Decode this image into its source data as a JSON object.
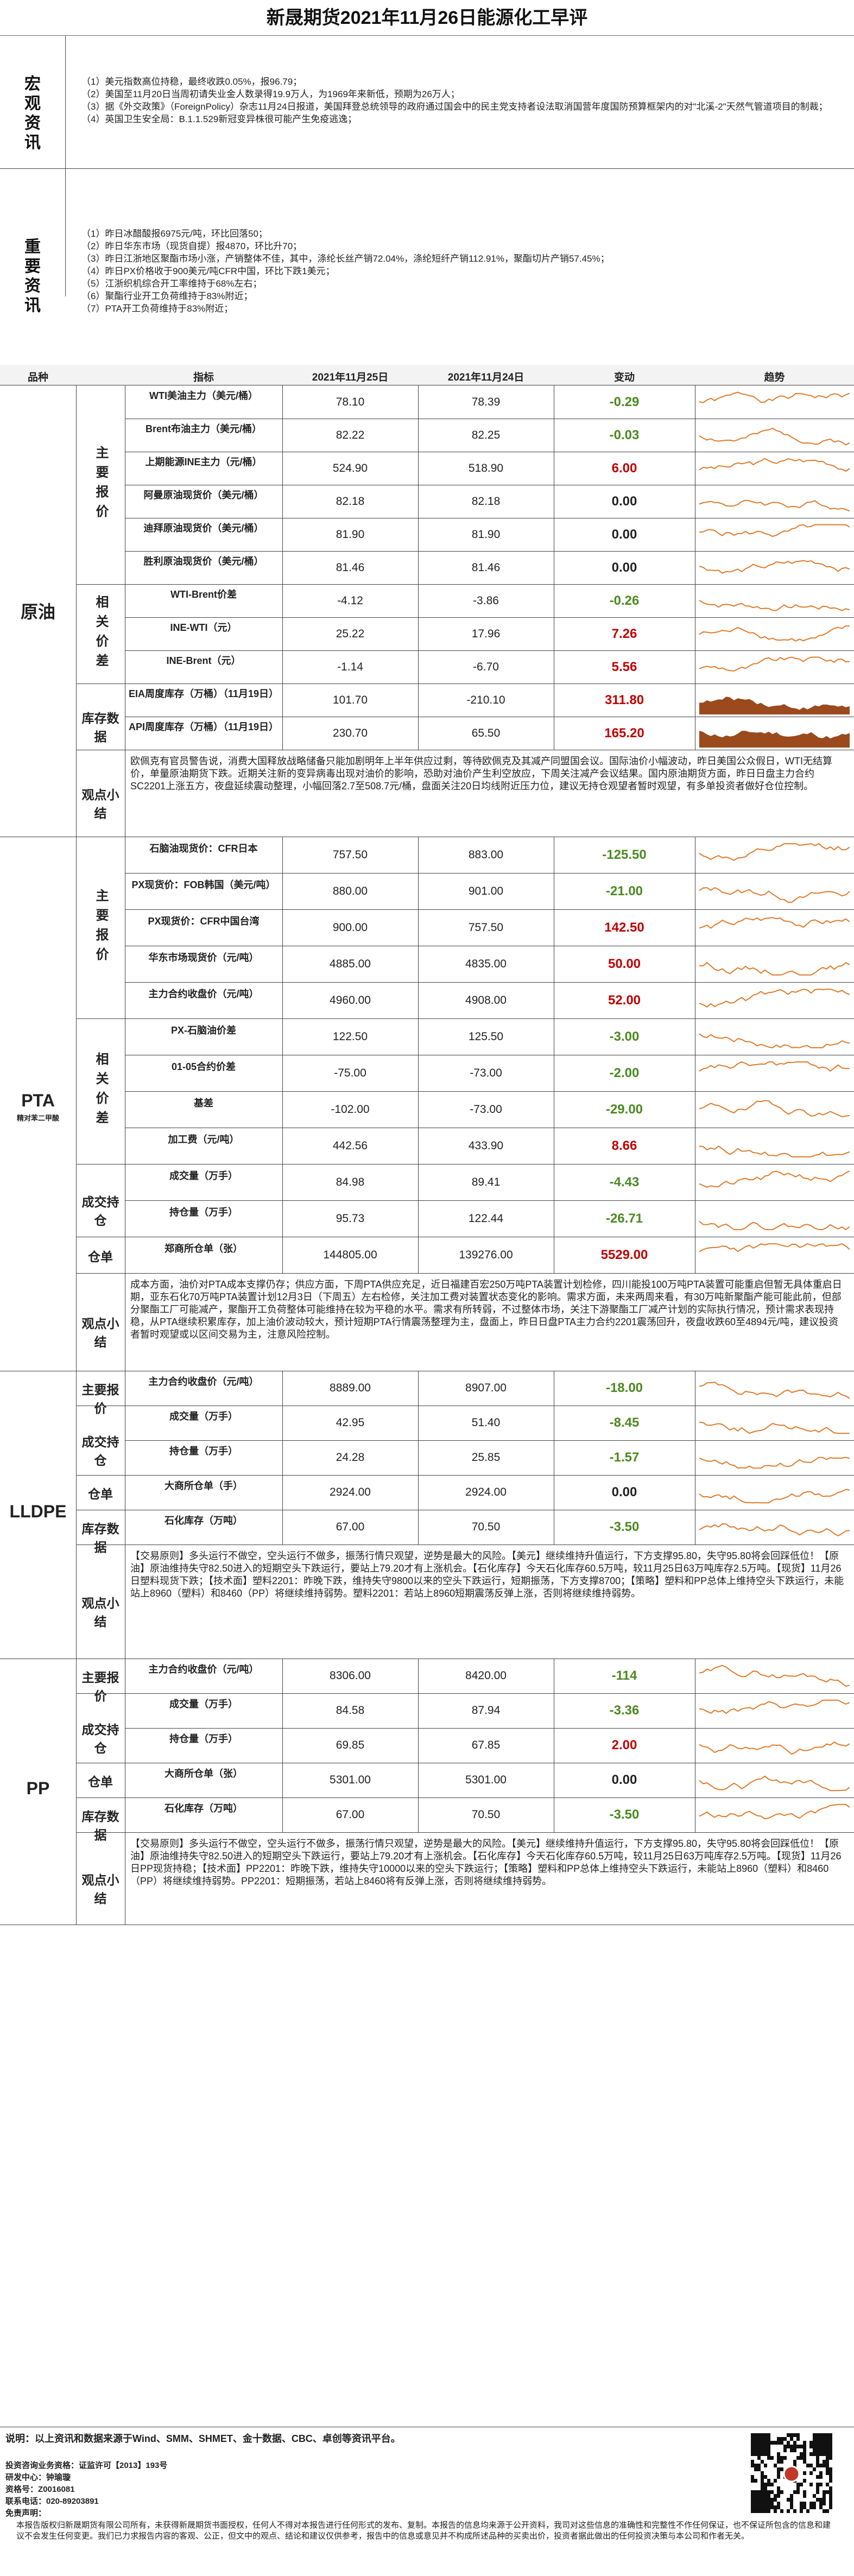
{
  "title": "新晟期货2021年11月26日能源化工早评",
  "macro": {
    "label": "宏观资讯",
    "items": [
      "（1）美元指数高位持稳，最终收跌0.05%，报96.79；",
      "（2）美国至11月20日当周初请失业金人数录得19.9万人，为1969年来新低，预期为26万人；",
      "（3）据《外交政策》（ForeignPolicy）杂志11月24日报道，美国拜登总统领导的政府通过国会中的民主党支持者设法取消国营年度国防预算框架内的对\"北溪-2\"天然气管道项目的制裁；",
      "（4）英国卫生安全局：B.1.1.529新冠变异株很可能产生免疫逃逸；"
    ]
  },
  "important": {
    "label": "重要资讯",
    "items": [
      "（1）昨日冰醋酸报6975元/吨，环比回落50；",
      "（2）昨日华东市场（现货自提）报4870，环比升70；",
      "（3）昨日江浙地区聚酯市场小涨，产销整体不佳，其中，涤纶长丝产销72.04%，涤纶短纤产销112.91%，聚酯切片产销57.45%；",
      "（4）昨日PX价格收于900美元/吨CFR中国，环比下跌1美元；",
      "（5）江浙织机综合开工率维持于68%左右；",
      "（6）聚酯行业开工负荷维持于83%附近；",
      "（7）PTA开工负荷维持于83%附近；"
    ]
  },
  "table_header": {
    "product": "品种",
    "indicator": "指标",
    "date1": "2021年11月25日",
    "date2": "2021年11月24日",
    "change": "变动",
    "trend": "趋势"
  },
  "crude": {
    "name": "原油",
    "main_label": "主要报价",
    "rel_label": "相关价差",
    "inv_label": "库存数据",
    "summary_label": "观点小结",
    "rows": [
      {
        "name": "WTI美油主力（美元/桶）",
        "v1": "78.10",
        "v2": "78.39",
        "chg": "-0.29",
        "s": "neg"
      },
      {
        "name": "Brent布油主力（美元/桶）",
        "v1": "82.22",
        "v2": "82.25",
        "chg": "-0.03",
        "s": "neg"
      },
      {
        "name": "上期能源INE主力（元/桶）",
        "v1": "524.90",
        "v2": "518.90",
        "chg": "6.00",
        "s": "pos"
      },
      {
        "name": "阿曼原油现货价（美元/桶）",
        "v1": "82.18",
        "v2": "82.18",
        "chg": "0.00",
        "s": "zero"
      },
      {
        "name": "迪拜原油现货价（美元/桶）",
        "v1": "81.90",
        "v2": "81.90",
        "chg": "0.00",
        "s": "zero"
      },
      {
        "name": "胜利原油现货价（美元/桶）",
        "v1": "81.46",
        "v2": "81.46",
        "chg": "0.00",
        "s": "zero"
      },
      {
        "name": "WTI-Brent价差",
        "v1": "-4.12",
        "v2": "-3.86",
        "chg": "-0.26",
        "s": "neg"
      },
      {
        "name": "INE-WTI（元）",
        "v1": "25.22",
        "v2": "17.96",
        "chg": "7.26",
        "s": "pos"
      },
      {
        "name": "INE-Brent（元）",
        "v1": "-1.14",
        "v2": "-6.70",
        "chg": "5.56",
        "s": "pos"
      },
      {
        "name": "EIA周度库存（万桶）（11月19日）",
        "v1": "101.70",
        "v2": "-210.10",
        "chg": "311.80",
        "s": "pos"
      },
      {
        "name": "API周度库存（万桶）（11月19日）",
        "v1": "230.70",
        "v2": "65.50",
        "chg": "165.20",
        "s": "pos"
      }
    ],
    "summary": "欧佩克有官员警告说，消费大国释放战略储备只能加剧明年上半年供应过剩，等待欧佩克及其减产同盟国会议。国际油价小幅波动，昨日美国公众假日，WTI无结算价，单量原油期货下跌。近期关注新的变异病毒出现对油价的影响，恐助对油价产生利空放应，下周关注减产会议结果。国内原油期货方面，昨日日盘主力合约SC2201上涨五方，夜盘延续震动整理，小幅回落2.7至508.7元/桶，盘面关注20日均线附近压力位，建议无持仓观望者暂时观望，有多单投资者做好仓位控制。"
  },
  "pta": {
    "name": "PTA",
    "sub": "精对苯二甲酸",
    "main_label": "主要报价",
    "rel_label": "相关价差",
    "vol_label": "成交持仓",
    "wh_label": "仓单",
    "summary_label": "观点小结",
    "rows": [
      {
        "name": "石脑油现货价：CFR日本",
        "v1": "757.50",
        "v2": "883.00",
        "chg": "-125.50",
        "s": "neg"
      },
      {
        "name": "PX现货价：FOB韩国（美元/吨）",
        "v1": "880.00",
        "v2": "901.00",
        "chg": "-21.00",
        "s": "neg"
      },
      {
        "name": "PX现货价：CFR中国台湾",
        "v1": "900.00",
        "v2": "757.50",
        "chg": "142.50",
        "s": "pos"
      },
      {
        "name": "华东市场现货价（元/吨）",
        "v1": "4885.00",
        "v2": "4835.00",
        "chg": "50.00",
        "s": "pos"
      },
      {
        "name": "主力合约收盘价（元/吨）",
        "v1": "4960.00",
        "v2": "4908.00",
        "chg": "52.00",
        "s": "pos"
      },
      {
        "name": "PX-石脑油价差",
        "v1": "122.50",
        "v2": "125.50",
        "chg": "-3.00",
        "s": "neg"
      },
      {
        "name": "01-05合约价差",
        "v1": "-75.00",
        "v2": "-73.00",
        "chg": "-2.00",
        "s": "neg"
      },
      {
        "name": "基差",
        "v1": "-102.00",
        "v2": "-73.00",
        "chg": "-29.00",
        "s": "neg"
      },
      {
        "name": "加工费（元/吨）",
        "v1": "442.56",
        "v2": "433.90",
        "chg": "8.66",
        "s": "pos"
      },
      {
        "name": "成交量（万手）",
        "v1": "84.98",
        "v2": "89.41",
        "chg": "-4.43",
        "s": "neg"
      },
      {
        "name": "持仓量（万手）",
        "v1": "95.73",
        "v2": "122.44",
        "chg": "-26.71",
        "s": "neg"
      },
      {
        "name": "郑商所仓单（张）",
        "v1": "144805.00",
        "v2": "139276.00",
        "chg": "5529.00",
        "s": "pos"
      }
    ],
    "summary": "成本方面，油价对PTA成本支撑仍存；供应方面，下周PTA供应充足，近日福建百宏250万吨PTA装置计划检修，四川能投100万吨PTA装置可能重启但暂无具体重启日期，亚东石化70万吨PTA装置计划12月3日（下周五）左右检修，关注加工费对装置状态变化的影响。需求方面，未来两周来看，有30万吨新聚酯产能可能此前，但部分聚酯工厂可能减产，聚酯开工负荷整体可能维持在较为平稳的水平。需求有所转弱，不过整体市场，关注下游聚酯工厂减产计划的实际执行情况，预计需求表现持稳，从PTA继续积累库存，加上油价波动较大，预计短期PTA行情震荡整理为主，盘面上，昨日日盘PTA主力合约2201震荡回升，夜盘收跌60至4894元/吨，建议投资者暂时观望或以区间交易为主，注意风险控制。"
  },
  "lldpe": {
    "name": "LLDPE",
    "main_label": "主要报价",
    "vol_label": "成交持仓",
    "wh_label": "仓单",
    "inv_label": "库存数据",
    "summary_label": "观点小结",
    "rows": [
      {
        "name": "主力合约收盘价（元/吨）",
        "v1": "8889.00",
        "v2": "8907.00",
        "chg": "-18.00",
        "s": "neg"
      },
      {
        "name": "成交量（万手）",
        "v1": "42.95",
        "v2": "51.40",
        "chg": "-8.45",
        "s": "neg"
      },
      {
        "name": "持仓量（万手）",
        "v1": "24.28",
        "v2": "25.85",
        "chg": "-1.57",
        "s": "neg"
      },
      {
        "name": "大商所仓单（手）",
        "v1": "2924.00",
        "v2": "2924.00",
        "chg": "0.00",
        "s": "zero"
      },
      {
        "name": "石化库存（万吨）",
        "v1": "67.00",
        "v2": "70.50",
        "chg": "-3.50",
        "s": "neg"
      }
    ],
    "summary": "【交易原则】多头运行不做空，空头运行不做多，振荡行情只观望，逆势是最大的风险。【美元】继续维持升值运行，下方支撑95.80，失守95.80将会回踩低位！【原油】原油维持失守82.50进入的短期空头下跌运行，要站上79.20才有上涨机会。【石化库存】今天石化库存60.5万吨，较11月25日63万吨库存2.5万吨。【现货】11月26日塑料现货下跌；【技术面】塑料2201：昨晚下跌，维持失守9800以来的空头下跌运行，短期振荡，下方支撑8700；【策略】塑料和PP总体上维持空头下跌运行，未能站上8960（塑料）和8460（PP）将继续维持弱势。塑料2201：若站上8960短期震荡反弹上涨，否则将继续维持弱势。"
  },
  "pp": {
    "name": "PP",
    "main_label": "主要报价",
    "vol_label": "成交持仓",
    "wh_label": "仓单",
    "inv_label": "库存数据",
    "summary_label": "观点小结",
    "rows": [
      {
        "name": "主力合约收盘价（元/吨）",
        "v1": "8306.00",
        "v2": "8420.00",
        "chg": "-114",
        "s": "neg"
      },
      {
        "name": "成交量（万手）",
        "v1": "84.58",
        "v2": "87.94",
        "chg": "-3.36",
        "s": "neg"
      },
      {
        "name": "持仓量（万手）",
        "v1": "69.85",
        "v2": "67.85",
        "chg": "2.00",
        "s": "pos"
      },
      {
        "name": "大商所仓单（张）",
        "v1": "5301.00",
        "v2": "5301.00",
        "chg": "0.00",
        "s": "zero"
      },
      {
        "name": "石化库存（万吨）",
        "v1": "67.00",
        "v2": "70.50",
        "chg": "-3.50",
        "s": "neg"
      }
    ],
    "summary": "【交易原则】多头运行不做空，空头运行不做多，振荡行情只观望，逆势是最大的风险。【美元】继续维持升值运行，下方支撑95.80，失守95.80将会回踩低位！【原油】原油维持失守82.50进入的短期空头下跌运行，要站上79.20才有上涨机会。【石化库存】今天石化库存60.5万吨，较11月25日63万吨库存2.5万吨。【现货】11月26日PP现货持稳；【技术面】PP2201：昨晚下跌，维持失守10000以来的空头下跌运行；【策略】塑料和PP总体上维持空头下跌运行，未能站上8960（塑料）和8460（PP）将继续维持弱势。PP2201：短期振荡，若站上8460将有反弹上涨，否则将继续维持弱势。"
  },
  "footer": {
    "source": "说明：以上资讯和数据来源于Wind、SMM、SHMET、金十数据、CBC、卓创等资讯平台。",
    "license": "投资咨询业务资格：证监许可【2013】193号",
    "researcher": "研发中心：钟瑜璇",
    "cert": "资格号：Z0016081",
    "phone": "联系电话：020-89203891",
    "disclaimer_title": "免责声明：",
    "disclaimer": "本报告版权归新晟期货有限公司所有，未获得新晟期货书面授权，任何人不得对本报告进行任何形式的发布、复制。本报告的信息均来源于公开资料，我司对这些信息的准确性和完整性不作任何保证，也不保证所包含的信息和建议不会发生任何变更。我们已力求报告内容的客观、公正，但文中的观点、结论和建议仅供参考，报告中的信息或意见并不构成所述品种的买卖出价，投资者据此做出的任何投资决策与本公司和作者无关。"
  },
  "colors": {
    "pos": "#c00000",
    "neg": "#4a8a1f",
    "spark": "#e07a2a",
    "area": "#9a4a1c"
  }
}
